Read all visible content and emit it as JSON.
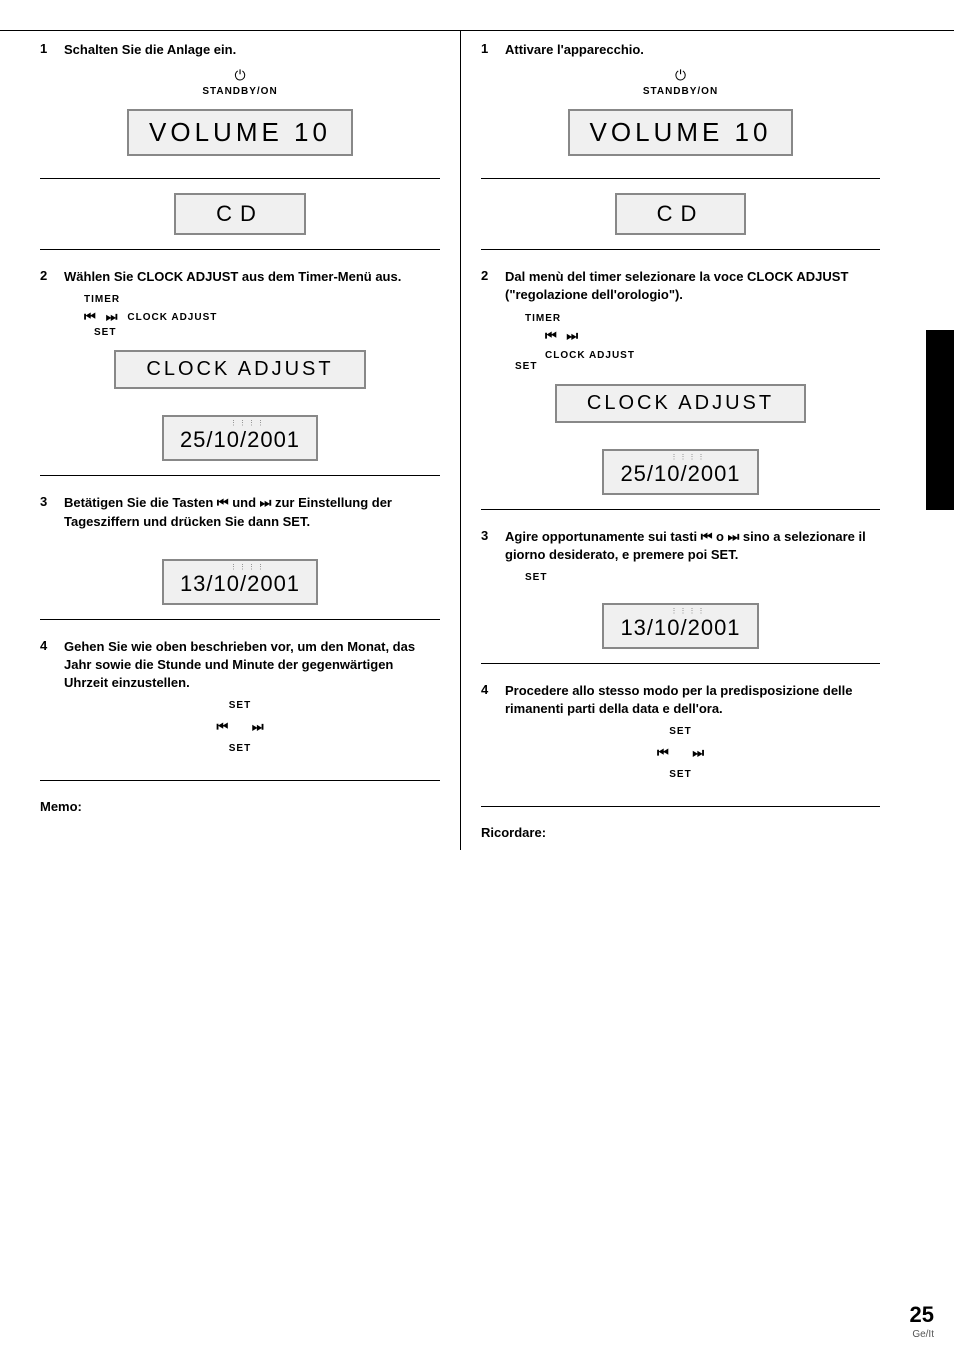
{
  "page": {
    "number": "25",
    "lang": "Ge/It"
  },
  "left_column": {
    "step1": {
      "number": "1",
      "text": "Schalten Sie die Anlage ein.",
      "power_icon": "⏻",
      "standby_label": "STANDBY/ON",
      "display_volume": "VOLUME   10"
    },
    "display_cd": "CD",
    "step2": {
      "number": "2",
      "text": "Wählen Sie CLOCK ADJUST aus dem Timer-Menü aus.",
      "timer_label": "TIMER",
      "nav_left": "⏮",
      "nav_right": "⏭",
      "clock_adjust_label": "CLOCK ADJUST",
      "set_label": "SET",
      "display_clock": "CLOCK  ADJUST"
    },
    "date_display1": "25/10/2001",
    "step3": {
      "number": "3",
      "text": "Betätigen Sie die Tasten ⏮ und ⏭ zur Einstellung der Tagesziffern und drücken Sie dann SET."
    },
    "date_display2": "13/10/2001",
    "step4": {
      "number": "4",
      "text": "Gehen Sie wie oben beschrieben vor, um den Monat, das Jahr sowie die Stunde und Minute der gegenwärtigen Uhrzeit einzustellen.",
      "set_label": "SET",
      "nav_left": "⏮",
      "nav_right": "⏭",
      "set_label2": "SET"
    },
    "memo": "Memo:"
  },
  "right_column": {
    "step1": {
      "number": "1",
      "text": "Attivare l'apparecchio.",
      "power_icon": "⏻",
      "standby_label": "STANDBY/ON",
      "display_volume": "VOLUME   10"
    },
    "display_cd": "CD",
    "step2": {
      "number": "2",
      "text": "Dal menù del timer selezionare la voce CLOCK ADJUST (\"regolazione dell'orologio\").",
      "timer_label": "TIMER",
      "nav_left": "⏮",
      "nav_right": "⏭",
      "clock_adjust_label": "CLOCK ADJUST",
      "set_label": "SET",
      "display_clock": "CLOCK  ADJUST"
    },
    "date_display1": "25/10/2001",
    "step3": {
      "number": "3",
      "text": "Agire opportunamente sui tasti ⏮ o ⏭ sino a selezionare il giorno desiderato, e premere poi SET.",
      "set_label": "SET"
    },
    "date_display2": "13/10/2001",
    "step4": {
      "number": "4",
      "text": "Procedere allo stesso modo per la predisposizione delle rimanenti parti della data e dell'ora.",
      "set_label": "SET",
      "nav_left": "⏮",
      "nav_right": "⏭",
      "set_label2": "SET"
    },
    "ricordare": "Ricordare:"
  }
}
